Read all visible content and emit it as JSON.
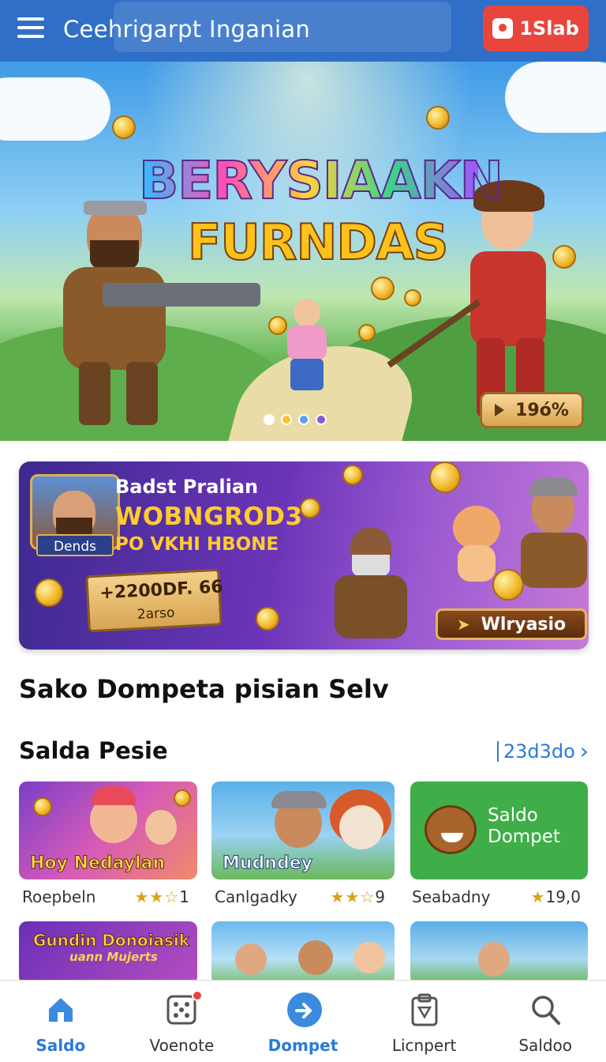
{
  "header": {
    "title": "Ceehrigarpt Inganian",
    "login_label": "1Slab"
  },
  "hero": {
    "title_line1": "BERYSIAAKN",
    "title_line2": "FURNDAS",
    "badge": "19ó%",
    "dots": [
      "#ffffff",
      "#f4c430",
      "#5ba0e8",
      "#8a5cc9"
    ]
  },
  "promo": {
    "avatar_label": "Dends",
    "line1": "Badst Pralian",
    "line2": "WOBNGROD3",
    "line3": "PO VKHI HBONE",
    "plaque_value": "+2200DF. 66",
    "plaque_sub": "2arso",
    "cta": "Wlryasio"
  },
  "section_title": "Sako Dompeta pisian Selv",
  "games_section": {
    "title": "Salda Pesie",
    "see_all": "23d3do"
  },
  "games": [
    {
      "caption": "Hoy Nedaylan",
      "name": "Roepbeln",
      "stars": "★★☆",
      "rating": "1"
    },
    {
      "caption": "Mudndey",
      "name": "Canlgadky",
      "stars": "★★☆",
      "rating": "9"
    },
    {
      "caption": "Saldo Dompet",
      "name": "Seabadny",
      "stars": "★",
      "rating": "19,0"
    }
  ],
  "games_row2": [
    {
      "caption": "Gundin Donoiasik",
      "subcaption": "uann Mujerts"
    }
  ],
  "bottom_nav": [
    {
      "label": "Saldo",
      "icon": "home-icon",
      "active": true
    },
    {
      "label": "Voenote",
      "icon": "dice-icon"
    },
    {
      "label": "Dompet",
      "icon": "arrow-circle-icon"
    },
    {
      "label": "Licnpert",
      "icon": "clipboard-icon"
    },
    {
      "label": "Saldoo",
      "icon": "search-icon"
    }
  ],
  "colors": {
    "header_bg": "#2f6fc8",
    "login_bg": "#e8453c",
    "accent_blue": "#2a7ad9",
    "green_card": "#3fae48"
  }
}
